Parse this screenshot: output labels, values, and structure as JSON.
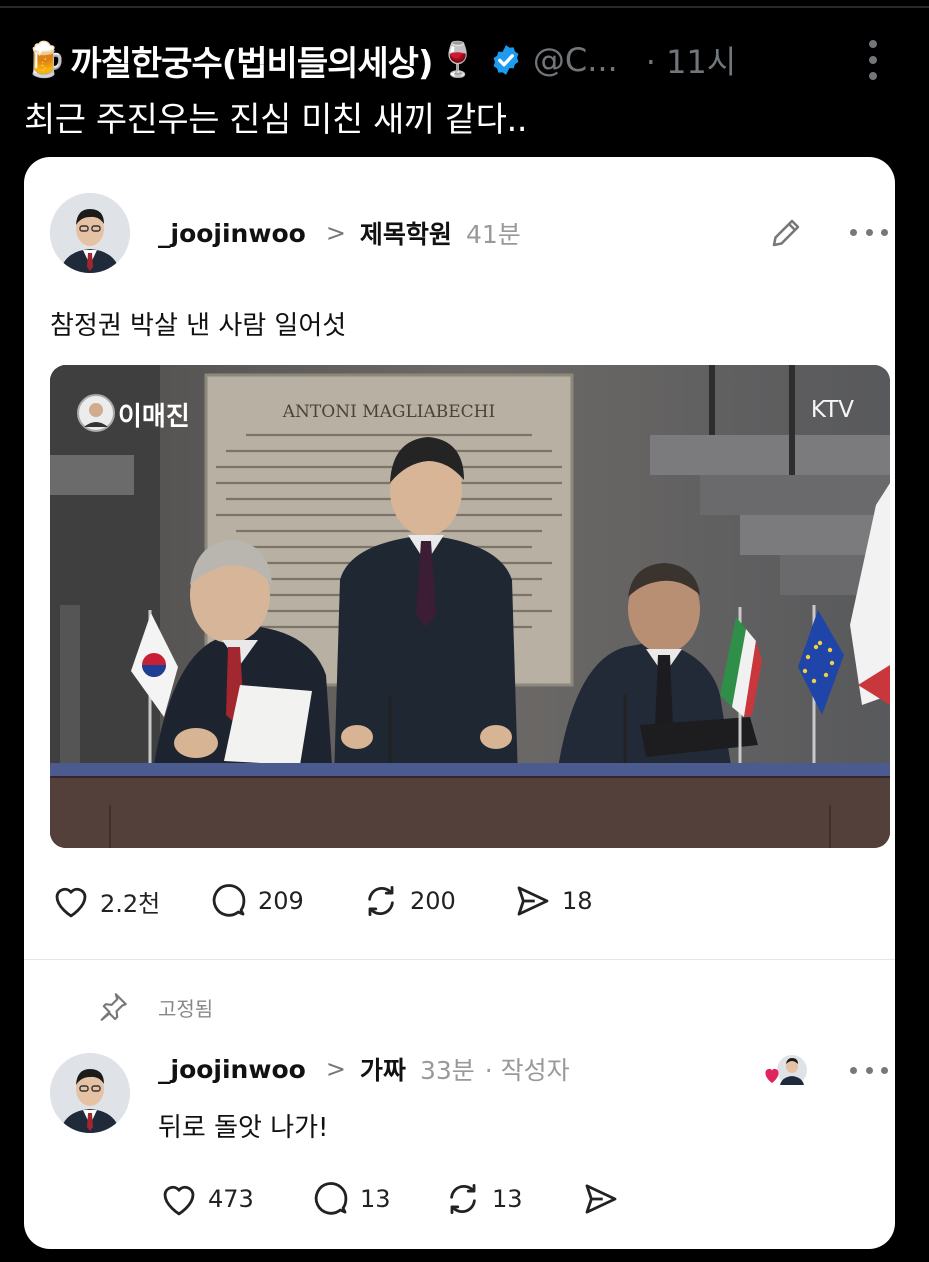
{
  "tweet": {
    "author_emoji_left": "🍺",
    "author_name": "까칠한궁수(법비들의세상)",
    "author_emoji_right": "🍷",
    "handle": "@C...",
    "time": "· 11시",
    "text": "최근 주진우는 진심 미친 새끼 같다.."
  },
  "post": {
    "username": "_joojinwoo",
    "topic": "제목학원",
    "ago": "41분",
    "body": "참정권 박살 낸 사람 일어섯",
    "image": {
      "watermark_left": "이매진",
      "watermark_right": "KTV",
      "plaque_title": "ANTONI MAGLIABECHI"
    },
    "stats": {
      "likes": "2.2천",
      "replies": "209",
      "reposts": "200",
      "shares": "18"
    }
  },
  "pinned_label": "고정됨",
  "reply": {
    "username": "_joojinwoo",
    "topic": "가짜",
    "ago": "33분",
    "author_tag": "· 작성자",
    "body": "뒤로 돌앗 나가!",
    "stats": {
      "likes": "473",
      "replies": "13",
      "reposts": "13"
    }
  },
  "colors": {
    "background": "#000000",
    "card": "#ffffff",
    "verified": "#1d9bf0",
    "muted": "#71767b",
    "heart": "#e0245e"
  },
  "icons": [
    "verified-badge-icon",
    "more-vertical-icon",
    "pencil-icon",
    "more-horizontal-icon",
    "heart-icon",
    "comment-icon",
    "repost-icon",
    "share-icon",
    "pin-icon"
  ]
}
